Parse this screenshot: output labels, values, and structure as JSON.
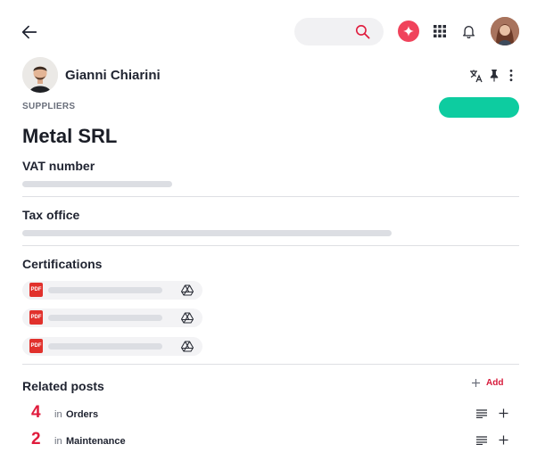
{
  "author": {
    "name": "Gianni Chiarini"
  },
  "post": {
    "category": "SUPPLIERS",
    "title": "Metal SRL"
  },
  "fields": [
    {
      "label": "VAT number"
    },
    {
      "label": "Tax office"
    },
    {
      "label": "Certifications"
    }
  ],
  "certifications": [
    {
      "type_badge": "PDF"
    },
    {
      "type_badge": "PDF"
    },
    {
      "type_badge": "PDF"
    }
  ],
  "related": {
    "label": "Related posts",
    "add_label": "Add",
    "items": [
      {
        "count": "4",
        "prefix": "in",
        "name": "Orders"
      },
      {
        "count": "2",
        "prefix": "in",
        "name": "Maintenance"
      }
    ]
  },
  "colors": {
    "accent": "#e01b3c",
    "status": "#0dcca0",
    "ai_button": "#f0435b",
    "pdf": "#e1312c"
  },
  "icons": [
    "back-arrow-icon",
    "search-icon",
    "sparkle-icon",
    "apps-grid-icon",
    "bell-icon",
    "translate-icon",
    "pin-icon",
    "more-vertical-icon",
    "pdf-icon",
    "google-drive-icon",
    "plus-icon",
    "lines-icon"
  ]
}
